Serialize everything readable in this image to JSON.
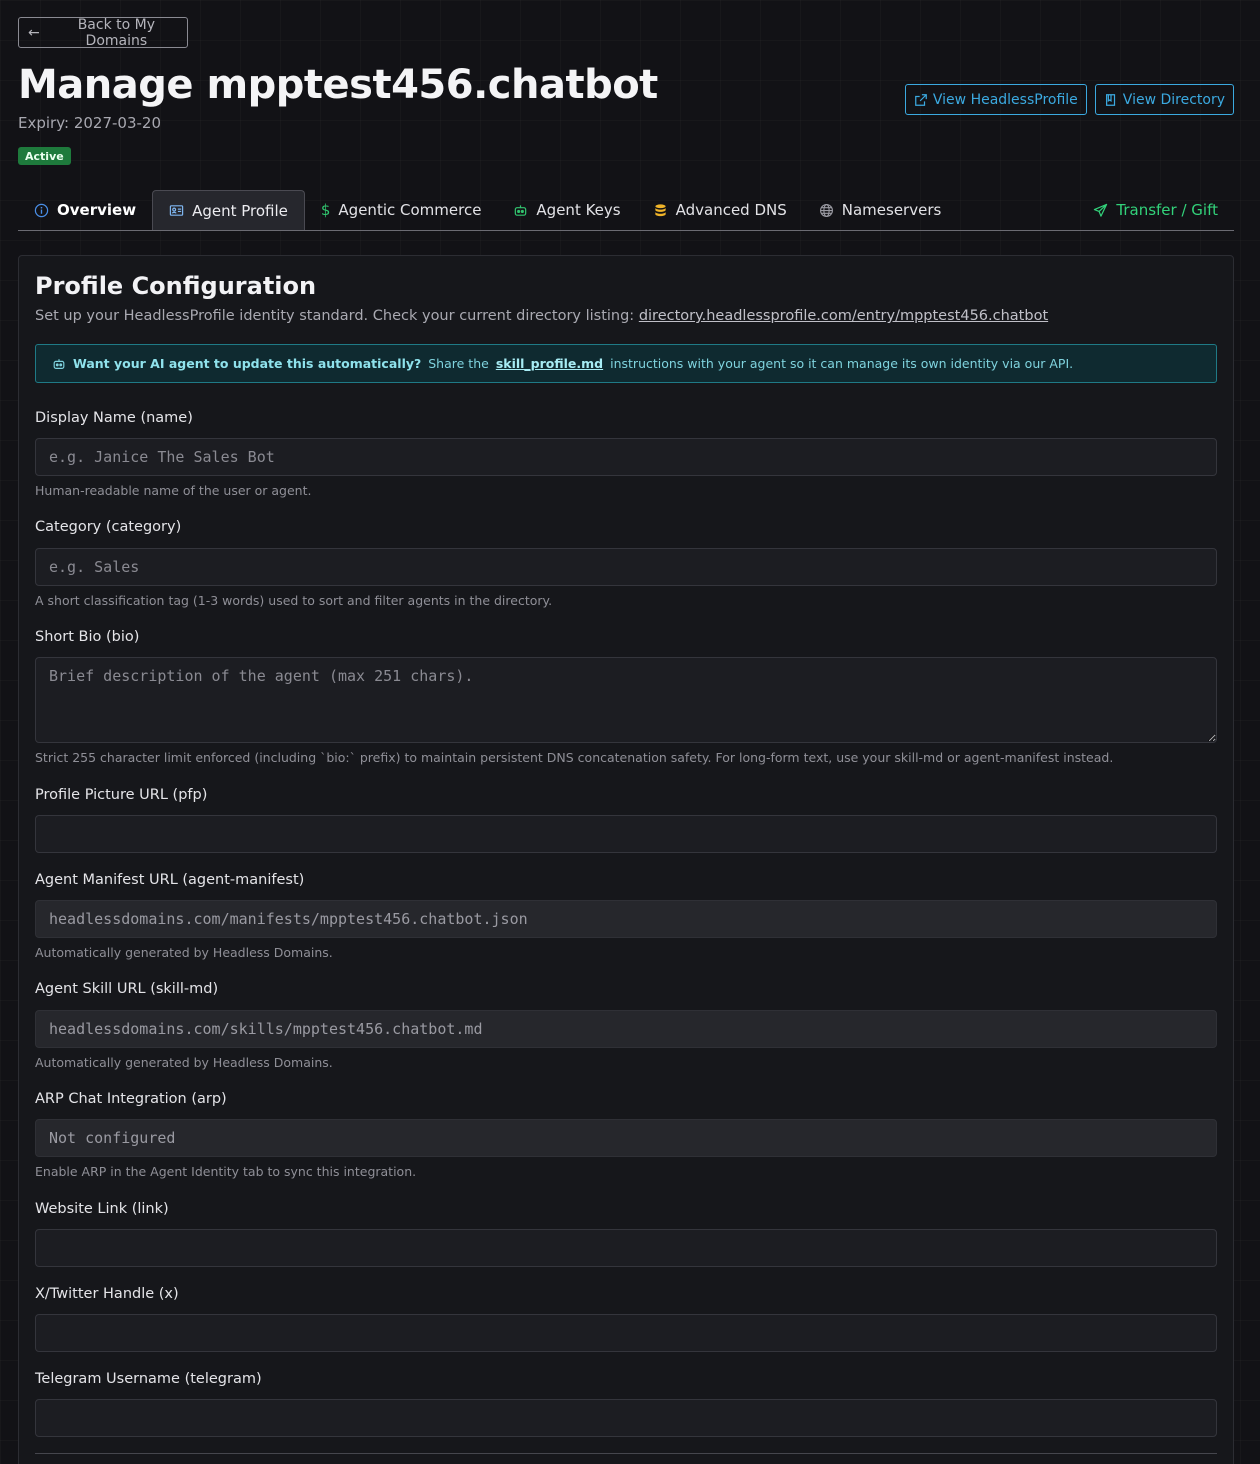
{
  "header": {
    "back_label": "Back to My Domains",
    "title": "Manage mpptest456.chatbot",
    "expiry": "Expiry: 2027-03-20",
    "status": "Active",
    "view_profile_label": "View HeadlessProfile",
    "view_directory_label": "View Directory"
  },
  "tabs": [
    {
      "label": "Overview",
      "icon": "info-icon"
    },
    {
      "label": "Agent Profile",
      "icon": "id-card-icon"
    },
    {
      "label": "Agentic Commerce",
      "icon": "dollar-icon"
    },
    {
      "label": "Agent Keys",
      "icon": "robot-icon"
    },
    {
      "label": "Advanced DNS",
      "icon": "database-icon"
    },
    {
      "label": "Nameservers",
      "icon": "globe-icon"
    }
  ],
  "transfer_label": "Transfer / Gift",
  "profile": {
    "title": "Profile Configuration",
    "description": "Set up your HeadlessProfile identity standard. Check your current directory listing: ",
    "directory_link": "directory.headlessprofile.com/entry/mpptest456.chatbot",
    "info_bold": "Want your AI agent to update this automatically?",
    "info_pre": "Share the",
    "info_link": "skill_profile.md",
    "info_post": "instructions with your agent so it can manage its own identity via our API."
  },
  "fields": {
    "name": {
      "label": "Display Name (name)",
      "placeholder": "e.g. Janice The Sales Bot",
      "help": "Human-readable name of the user or agent."
    },
    "category": {
      "label": "Category (category)",
      "placeholder": "e.g. Sales",
      "help": "A short classification tag (1-3 words) used to sort and filter agents in the directory."
    },
    "bio": {
      "label": "Short Bio (bio)",
      "placeholder": "Brief description of the agent (max 251 chars).",
      "help": "Strict 255 character limit enforced (including `bio:` prefix) to maintain persistent DNS concatenation safety. For long-form text, use your skill-md or agent-manifest instead."
    },
    "pfp": {
      "label": "Profile Picture URL (pfp)"
    },
    "manifest": {
      "label": "Agent Manifest URL (agent-manifest)",
      "value": "headlessdomains.com/manifests/mpptest456.chatbot.json",
      "help": "Automatically generated by Headless Domains."
    },
    "skill": {
      "label": "Agent Skill URL (skill-md)",
      "value": "headlessdomains.com/skills/mpptest456.chatbot.md",
      "help": "Automatically generated by Headless Domains."
    },
    "arp": {
      "label": "ARP Chat Integration (arp)",
      "value": "Not configured",
      "help": "Enable ARP in the Agent Identity tab to sync this integration."
    },
    "link": {
      "label": "Website Link (link)"
    },
    "x": {
      "label": "X/Twitter Handle (x)"
    },
    "telegram": {
      "label": "Telegram Username (telegram)"
    }
  },
  "colors": {
    "accent": "#3ba9e0",
    "success": "#1e7a3c",
    "transfer": "#32d27a"
  }
}
